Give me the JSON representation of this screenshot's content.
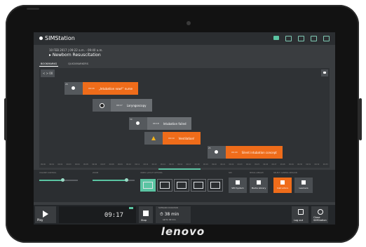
{
  "device": {
    "brand": "lenovo"
  },
  "app": {
    "name": "SIMStation"
  },
  "session": {
    "meta": "10 FEB 2017 | 09:22 a.m. - 09:40 a.m.",
    "title": "Newborn Resuscitation"
  },
  "tabs": [
    "BOOKMARKS",
    "QUICKMARKERS"
  ],
  "timeline": {
    "start_label": "< > 00",
    "events": [
      {
        "num": "28",
        "time": "09:16",
        "label": "„Intubation now!“ nurse",
        "style": "orange",
        "icon": "tube-icon"
      },
      {
        "num": "",
        "time": "09:17",
        "label": "Laryngoscopy",
        "style": "grey",
        "icon": "laryngoscope-icon"
      },
      {
        "num": "30",
        "time": "09:18",
        "label": "Intubation failed",
        "style": "grey",
        "icon": "speech-bubble-icon"
      },
      {
        "num": "",
        "time": "09:19",
        "label": "Ventilation!",
        "style": "orange",
        "icon": "warning-icon"
      },
      {
        "num": "25",
        "time": "09:20",
        "label": "Silent intubation concept",
        "style": "orange",
        "icon": "tube-icon"
      }
    ],
    "ticks": [
      "09:00",
      "09:01",
      "09:02",
      "09:03",
      "09:04",
      "09:05",
      "09:06",
      "09:07",
      "09:08",
      "09:09",
      "09:10",
      "09:11",
      "09:12",
      "09:13",
      "09:14",
      "09:15",
      "09:16",
      "09:17",
      "09:18",
      "09:19",
      "09:20",
      "09:21",
      "09:22",
      "09:23",
      "09:24",
      "09:25",
      "09:26",
      "09:27",
      "09:28",
      "09:29",
      "09:30",
      "09:31",
      "09:32",
      "09:33"
    ]
  },
  "controls": {
    "volume_label": "VOLUME CONTROL",
    "zoom_label": "ZOOM",
    "layout_label": "VIDEO LAYOUT OPTIONS",
    "sim_label": "SIM",
    "media_label": "MEDIA LIBRARY",
    "select_label": "SELECT CAMERA SESSION",
    "sim_button": "SIM System",
    "media_button": "Media Library",
    "instructors_button": "Instructors",
    "learners_button": "Learners"
  },
  "bottom": {
    "play_label": "Play",
    "timer_value": "09:17",
    "stop_label": "Stop",
    "duration_label": "SCENARIO DURATION",
    "duration_value": "38 min",
    "duration_sub": "set to 40 min",
    "logout_label": "Log out",
    "close_label": "Close SIMStation"
  },
  "colors": {
    "accent": "#5bc4a2",
    "orange": "#ef6c1a",
    "grey": "#6a6e72"
  }
}
